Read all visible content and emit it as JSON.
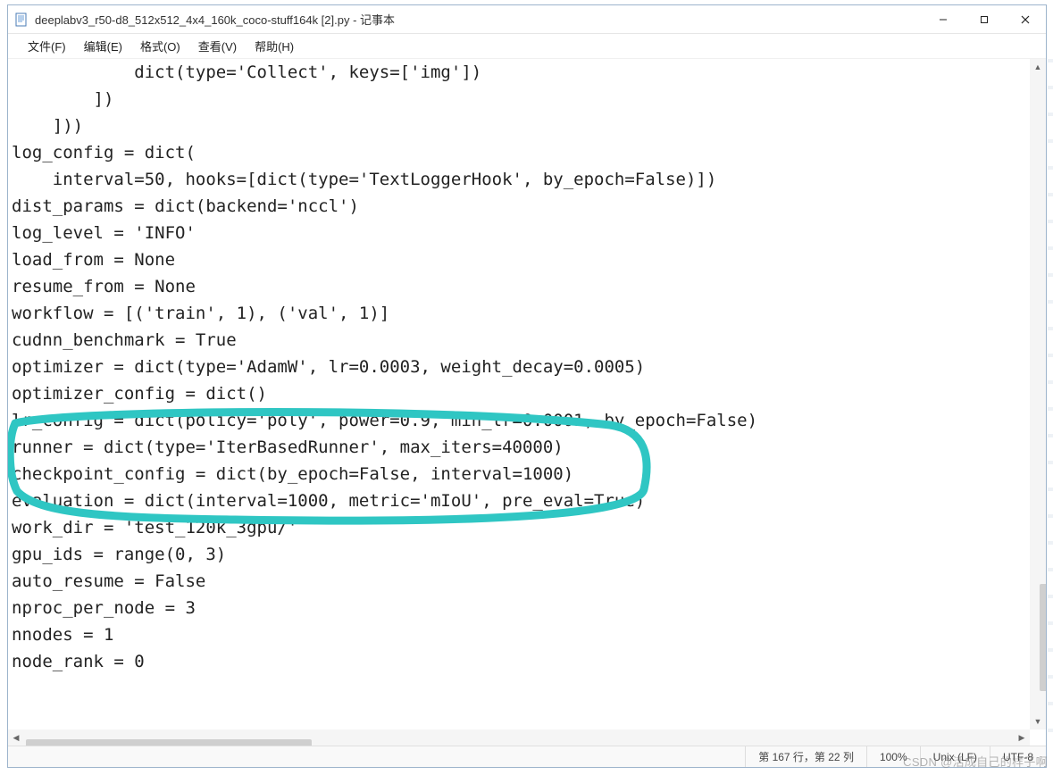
{
  "window": {
    "title": "deeplabv3_r50-d8_512x512_4x4_160k_coco-stuff164k [2].py - 记事本",
    "app_icon": "notepad-icon"
  },
  "menu": {
    "file": "文件(F)",
    "edit": "编辑(E)",
    "format": "格式(O)",
    "view": "查看(V)",
    "help": "帮助(H)"
  },
  "code": "            dict(type='Collect', keys=['img'])\n        ])\n    ]))\nlog_config = dict(\n    interval=50, hooks=[dict(type='TextLoggerHook', by_epoch=False)])\ndist_params = dict(backend='nccl')\nlog_level = 'INFO'\nload_from = None\nresume_from = None\nworkflow = [('train', 1), ('val', 1)]\ncudnn_benchmark = True\noptimizer = dict(type='AdamW', lr=0.0003, weight_decay=0.0005)\noptimizer_config = dict()\nlr_config = dict(policy='poly', power=0.9, min_lr=0.0001, by_epoch=False)\nrunner = dict(type='IterBasedRunner', max_iters=40000)\ncheckpoint_config = dict(by_epoch=False, interval=1000)\nevaluation = dict(interval=1000, metric='mIoU', pre_eval=True)\nwork_dir = 'test_120k_3gpu/'\ngpu_ids = range(0, 3)\nauto_resume = False\nnproc_per_node = 3\nnnodes = 1\nnode_rank = 0",
  "status": {
    "position": "第 167 行，第 22 列",
    "zoom": "100%",
    "line_ending": "Unix (LF)",
    "encoding": "UTF-8"
  },
  "watermark": "CSDN @活成自己的样子啊",
  "annotation_color": "#2fc6c3"
}
